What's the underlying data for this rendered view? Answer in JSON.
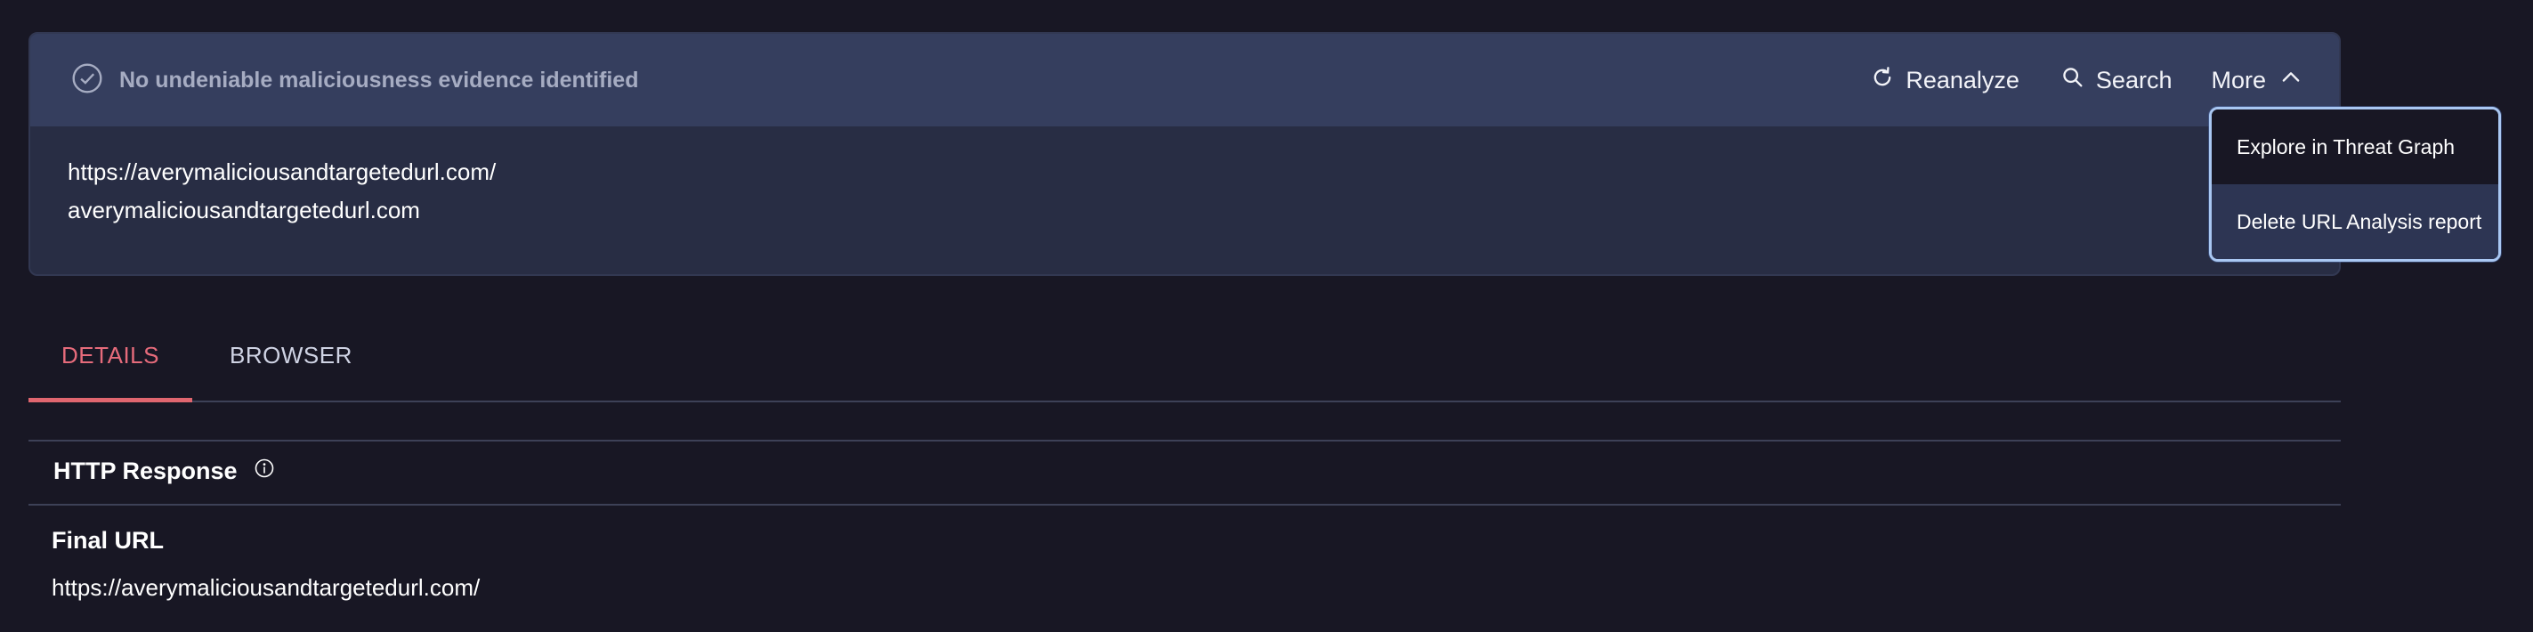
{
  "header": {
    "status_text": "No undeniable maliciousness evidence identified",
    "status_icon": "check-circle-icon",
    "actions": {
      "reanalyze_label": "Reanalyze",
      "search_label": "Search",
      "more_label": "More"
    }
  },
  "summary": {
    "url": "https://averymaliciousandtargetedurl.com/",
    "domain": "averymaliciousandtargetedurl.com"
  },
  "more_menu": {
    "items": [
      {
        "label": "Explore in Threat Graph"
      },
      {
        "label": "Delete URL Analysis report"
      }
    ]
  },
  "tabs": [
    {
      "label": "DETAILS",
      "active": true
    },
    {
      "label": "BROWSER",
      "active": false
    }
  ],
  "http_response": {
    "title": "HTTP Response",
    "final_url_label": "Final URL",
    "final_url_value": "https://averymaliciousandtargetedurl.com/"
  },
  "colors": {
    "background": "#181724",
    "card": "#282d44",
    "card_header": "#353e5e",
    "accent_tab": "#e66b7b",
    "menu_border": "#a9c7f2"
  }
}
